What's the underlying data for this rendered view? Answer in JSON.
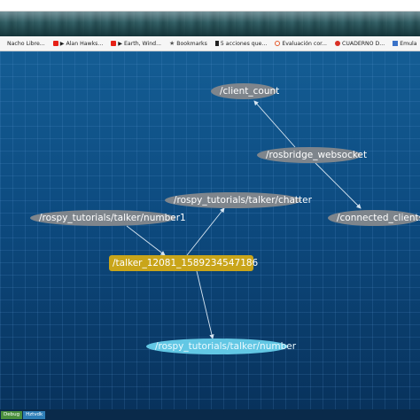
{
  "bookmarks": [
    {
      "label": "Nacho Libre...",
      "icon": "generic-icon"
    },
    {
      "label": "▶ Alan Hawks...",
      "icon": "youtube-icon"
    },
    {
      "label": "▶ Earth, Wind...",
      "icon": "youtube-icon"
    },
    {
      "label": "Bookmarks",
      "icon": "star-icon"
    },
    {
      "label": "5 acciones que...",
      "icon": "bar-icon"
    },
    {
      "label": "Evaluación cor...",
      "icon": "circle-icon"
    },
    {
      "label": "CUADERNO D...",
      "icon": "red-icon"
    },
    {
      "label": "Emula",
      "icon": "doc-icon"
    }
  ],
  "graph": {
    "client_count": "/client_count",
    "rosbridge_websocket": "/rosbridge_websocket",
    "chatter": "/rospy_tutorials/talker/chatter",
    "number1": "/rospy_tutorials/talker/number1",
    "connected_clients": "/connected_clients",
    "talker_node": "/talker_12081_1589234547186",
    "number": "/rospy_tutorials/talker/number"
  },
  "statusbar": {
    "left": "Debug",
    "right": "Hztvdk"
  },
  "colors": {
    "topic": "#7e858c",
    "node": "#c9a51a",
    "highlight_topic": "#62c7e4",
    "edge": "#d8e6f2"
  }
}
